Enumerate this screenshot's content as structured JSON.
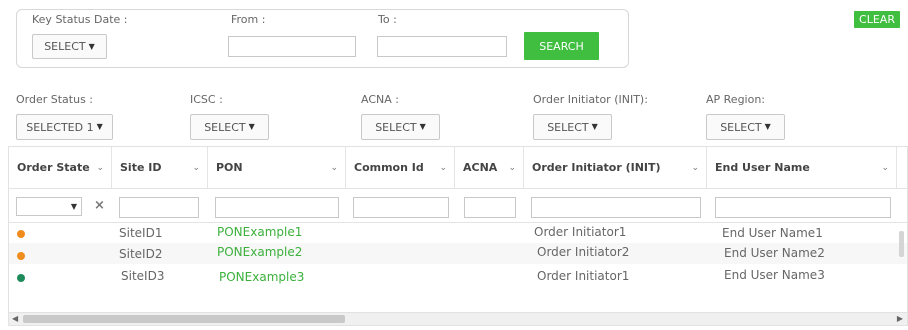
{
  "key_status": {
    "date_label": "Key Status Date :",
    "date_select": "SELECT",
    "from_label": "From :",
    "to_label": "To :",
    "from_value": "",
    "to_value": "",
    "search_label": "SEARCH"
  },
  "clear_label": "CLEAR",
  "filters": [
    {
      "label": "Order Status :",
      "value": "SELECTED 1"
    },
    {
      "label": "ICSC :",
      "value": "SELECT"
    },
    {
      "label": "ACNA :",
      "value": "SELECT"
    },
    {
      "label": "Order Initiator (INIT):",
      "value": "SELECT"
    },
    {
      "label": "AP Region:",
      "value": "SELECT"
    }
  ],
  "columns": [
    {
      "label": "Order State"
    },
    {
      "label": "Site ID"
    },
    {
      "label": "PON"
    },
    {
      "label": "Common Id"
    },
    {
      "label": "ACNA"
    },
    {
      "label": "Order Initiator (INIT)"
    },
    {
      "label": "End User Name"
    }
  ],
  "rows": [
    {
      "state_color": "#f08c1e",
      "site_id": "SiteID1",
      "pon": "PONExample1",
      "common_id": "",
      "acna": "",
      "initiator": "Order Initiator1",
      "end_user": "End User Name1"
    },
    {
      "state_color": "#f08c1e",
      "site_id": "SiteID2",
      "pon": "PONExample2",
      "common_id": "",
      "acna": "",
      "initiator": "Order Initiator2",
      "end_user": "End User Name2"
    },
    {
      "state_color": "#1f8a5a",
      "site_id": "SiteID3",
      "pon": "PONExample3",
      "common_id": "",
      "acna": "",
      "initiator": "Order Initiator1",
      "end_user": "End User Name3"
    }
  ],
  "colors": {
    "accent": "#3fbe3f",
    "status_orange": "#f08c1e",
    "status_green": "#1f8a5a"
  },
  "icons": {
    "dropdown": "caret-down-icon",
    "column_menu": "chevron-down-icon",
    "clear_filter": "close-icon"
  }
}
